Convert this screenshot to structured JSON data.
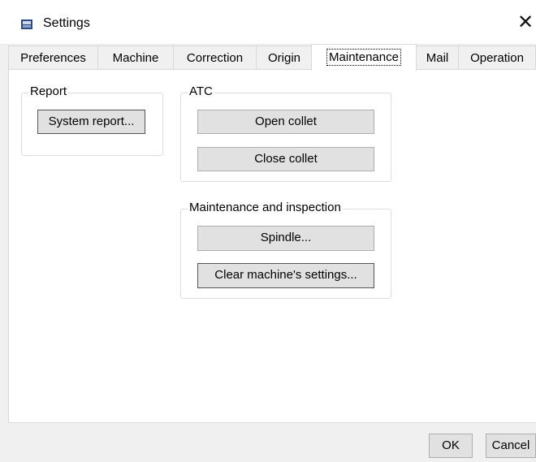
{
  "window": {
    "title": "Settings",
    "close_glyph": "✕",
    "icon": "settings-window-icon"
  },
  "tabs": [
    {
      "label": "Preferences",
      "active": false
    },
    {
      "label": "Machine",
      "active": false
    },
    {
      "label": "Correction",
      "active": false
    },
    {
      "label": "Origin",
      "active": false
    },
    {
      "label": "Maintenance",
      "active": true
    },
    {
      "label": "Mail",
      "active": false
    },
    {
      "label": "Operation",
      "active": false
    }
  ],
  "report_group": {
    "label": "Report",
    "system_report_button": "System report..."
  },
  "atc_group": {
    "label": "ATC",
    "open_collet_button": "Open collet",
    "close_collet_button": "Close collet"
  },
  "maintenance_group": {
    "label": "Maintenance and inspection",
    "spindle_button": "Spindle...",
    "clear_settings_button": "Clear machine's settings..."
  },
  "footer": {
    "ok_label": "OK",
    "cancel_label": "Cancel"
  }
}
